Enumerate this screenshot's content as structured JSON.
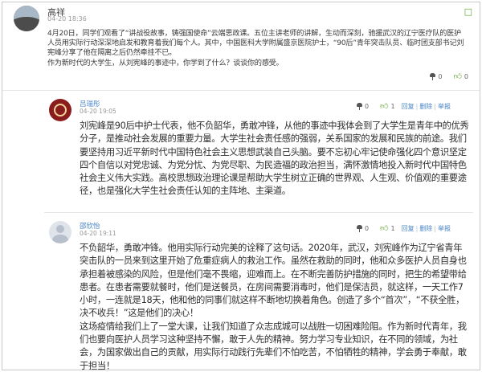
{
  "post": {
    "author": "高祥",
    "time": "04-20 18:36",
    "body": "4月20日，同学们观看了“讲战役故事，铸强国使命”云端思政课。五位主讲老师的讲解，生动而深刻，驰援武汉的辽宁医疗队的医护人员用实际行动深深地启发和教育着我们每个人。其中，中国医科大学附属盛京医院护士，“90后”青年突击队员、临时团支部书记刘宪峰分享了他在隔离之后仍然牵挂不已。\n作为新时代的大学生，从刘宪峰的事迹中，你学到了什么？谈谈你的感受。",
    "pin_count": "0",
    "like_count": "0"
  },
  "comments": [
    {
      "author": "吕瑞彤",
      "time": "04-20 19:05",
      "pin_count": "0",
      "like_count": "1",
      "reply_label": "回复",
      "delete_label": "删除",
      "report_label": "举报",
      "body": "刘宪峰是90后中护士代表，他不负韶华，勇敢冲锋，从他的事迹中我体会到了大学生是青年中的优秀分子，是推动社会发展的重要力量。大学生社会责任感的强弱，关系国家的发展和民族的前途。我们要坚持用习近平新时代中国特色社会主义思想武装自己头脑。要不忘初心牢记使命强化四个意识坚定四个自信以对党忠诚、为党分忧、为党尽职、为民造福的政治担当，满怀激情地投入新时代中国特色社会主义伟大实践。高校思想政治理论课是帮助大学生树立正确的世界观、人生观、价值观的重要途径，也是强化大学生社会责任认知的主阵地、主渠道。"
    },
    {
      "author": "邵欣怡",
      "time": "04-20 19:11",
      "pin_count": "0",
      "like_count": "1",
      "reply_label": "回复",
      "delete_label": "删除",
      "report_label": "举报",
      "body": "不负韶华，勇敢冲锋。他用实际行动完美的诠释了这句话。2020年，武汉，刘宪峰作为辽宁省青年突击队的一员来到这里开始了危重症病人的救治工作。虽然在救助的同时，他和众多医护人员自身也承担着被感染的风险，但是他们毫不畏缩，迎难而上。在不断完善防护措施的同时，把生的希望带给患者。在患者需要就餐时，他们是送餐员，在房间需要消毒时，他们是保洁员，就这样，一天工作7小时，一连就是18天，他和他的同事们就这样不断地切换着角色。创造了多个“首次”，“不获全胜，决不收兵！”这是他们的决心！\n这场疫情给我们上了一堂大课，让我们知道了众志成城可以战胜一切困难险阻。作为新时代青年，我们也要向医护人员学习这种坚持不懈，敢于人先的精神。努力学习专业知识，在不同的领域，为社会，为国家做出自己的贡献，用实际行动践行先辈们不怕吃苦，不怕牺牲的精神，学会勇于奉献，敢于担当！"
    }
  ],
  "icons": {
    "pin": "pin-icon",
    "like": "thumbs-up-icon",
    "corner": "expand-icon"
  },
  "colors": {
    "accent": "#4a86c8",
    "like": "#58a32a"
  }
}
